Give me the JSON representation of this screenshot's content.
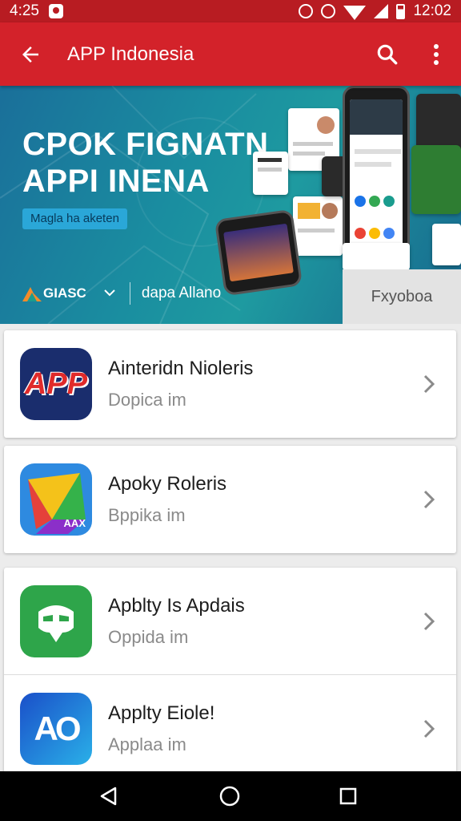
{
  "status_bar": {
    "left_text": "4:25",
    "time": "12:02"
  },
  "app_bar": {
    "title": "APP Indonesia",
    "back_icon": "arrow-left-icon",
    "search_icon": "search-icon",
    "more_icon": "more-vertical-icon"
  },
  "banner": {
    "headline_line1": "CPOK FIGNATN",
    "headline_line2": "APPI INENA",
    "tag": "Magla ha aketen",
    "brand": "GIASC",
    "brand_sub": "dapa Allano",
    "button_label": "Fxyoboa"
  },
  "apps": [
    {
      "name": "Ainteridn Nioleris",
      "subtitle": "Dopica im",
      "icon": "app-red-logo-icon"
    },
    {
      "name": "Apoky Roleris",
      "subtitle": "Bppika im",
      "icon": "colorful-triangle-icon"
    },
    {
      "name": "Apblty Is Apdais",
      "subtitle": "Oppida im",
      "icon": "green-mask-icon"
    },
    {
      "name": "Applty Eiole!",
      "subtitle": "Applaa im",
      "icon": "ao-logo-icon"
    }
  ],
  "icon_labels": {
    "app1_text": "APP",
    "app2_text": "AAX",
    "app4_text": "AO"
  },
  "colors": {
    "status_bar": "#b81c22",
    "app_bar": "#d3222a",
    "banner": "#1a8ea0",
    "nav_bar": "#000000"
  }
}
